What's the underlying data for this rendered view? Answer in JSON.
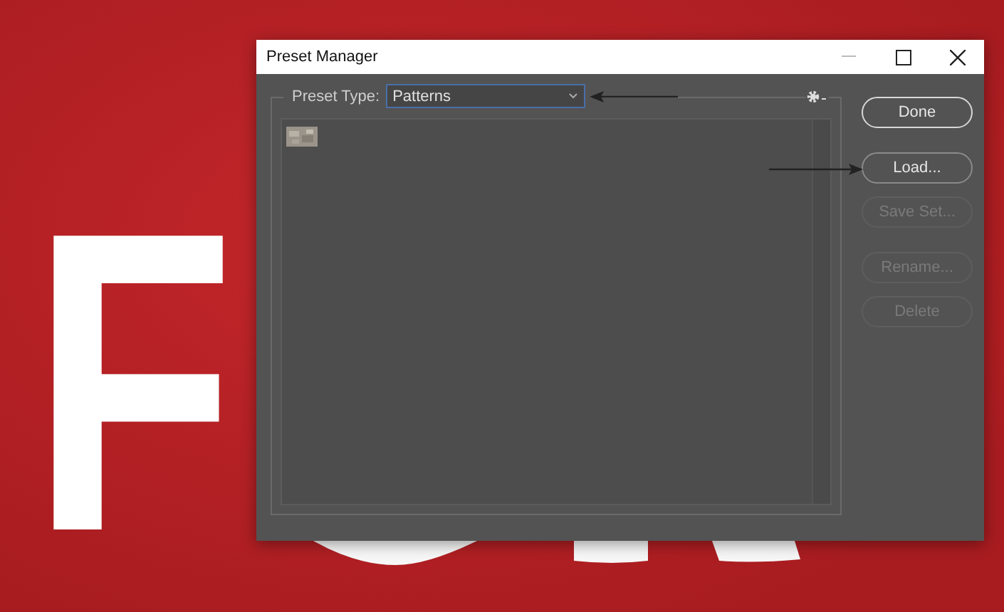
{
  "canvas": {
    "letter": "F"
  },
  "dialog": {
    "title": "Preset Manager",
    "preset_type": {
      "label": "Preset Type:",
      "value": "Patterns"
    },
    "buttons": [
      {
        "label": "Done",
        "default": true,
        "disabled": false
      },
      {
        "label": "Load...",
        "default": false,
        "disabled": false
      },
      {
        "label": "Save Set...",
        "default": false,
        "disabled": true
      },
      {
        "label": "Rename...",
        "default": false,
        "disabled": true
      },
      {
        "label": "Delete",
        "default": false,
        "disabled": true
      }
    ]
  }
}
